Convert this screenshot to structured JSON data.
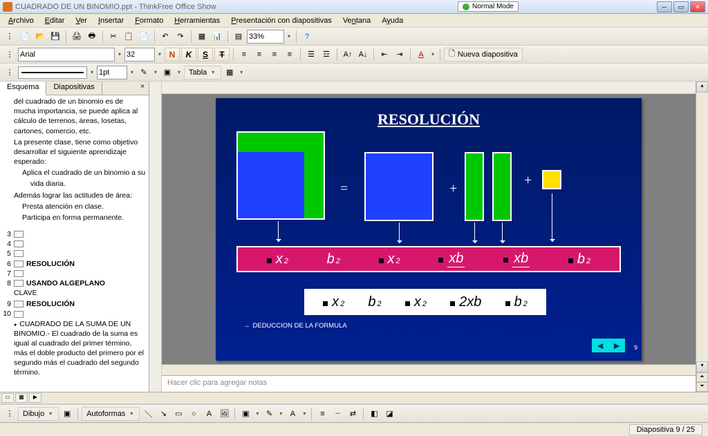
{
  "app": {
    "title": "CUADRADO DE UN BINOMIO.ppt - ThinkFree Office Show",
    "mode": "Normal Mode"
  },
  "menu": {
    "archivo": "Archivo",
    "editar": "Editar",
    "ver": "Ver",
    "insertar": "Insertar",
    "formato": "Formato",
    "herramientas": "Herramientas",
    "presentacion": "Presentación con diapositivas",
    "ventana": "Ventana",
    "ayuda": "Ayuda"
  },
  "toolbar": {
    "zoom": "33%",
    "font": "Arial",
    "size": "32",
    "btn_n": "N",
    "btn_k": "K",
    "btn_s": "S",
    "btn_t": "T",
    "nueva": "Nueva diapositiva",
    "linewidth": "1pt",
    "tabla": "Tabla"
  },
  "panel": {
    "tab_outline": "Esquema",
    "tab_slides": "Diapositivas"
  },
  "outline": {
    "p1": "del cuadrado de un binomio es de mucha importancia, se puede aplica al cálculo de terrenos, áreas, losetas, cartones, comercio, etc.",
    "p2": "La presente clase, tiene como objetivo desarrollar el siguiente aprendizaje esperado:",
    "p3": "Aplica el cuadrado de un binomio a su",
    "p4": "vida diaria.",
    "p5": "Además lograr las actitudes de área:",
    "p6": "Presta atención en clase.",
    "p7": "Participa en forma permanente.",
    "n3": "3",
    "n4": "4",
    "n5": "5",
    "n6": "6",
    "t6": "RESOLUCIÓN",
    "n7": "7",
    "n8": "8",
    "t8": "USANDO ALGEPLANO",
    "t8b": "CLAVE",
    "n9": "9",
    "t9": "RESOLUCIÓN",
    "n10": "10",
    "bul": "CUADRADO DE LA SUMA DE UN BINOMIO.- El cuadrado de la suma es igual al cuadrado del primer término, más el doble producto del primero por el segundo más el cuadrado del segundo término."
  },
  "slide": {
    "title": "RESOLUCIÓN",
    "eq": "=",
    "plus": "+",
    "x": "x",
    "b": "b",
    "two": "2",
    "twoxb": "2xb",
    "xb": "xb",
    "deduc": "DEDUCCION DE LA FORMULA",
    "num": "9"
  },
  "notes": {
    "placeholder": "Hacer clic para agregar notas"
  },
  "drawbar": {
    "dibujo": "Dibujo",
    "autoformas": "Autoformas"
  },
  "status": {
    "slide": "Diapositiva 9 / 25"
  }
}
